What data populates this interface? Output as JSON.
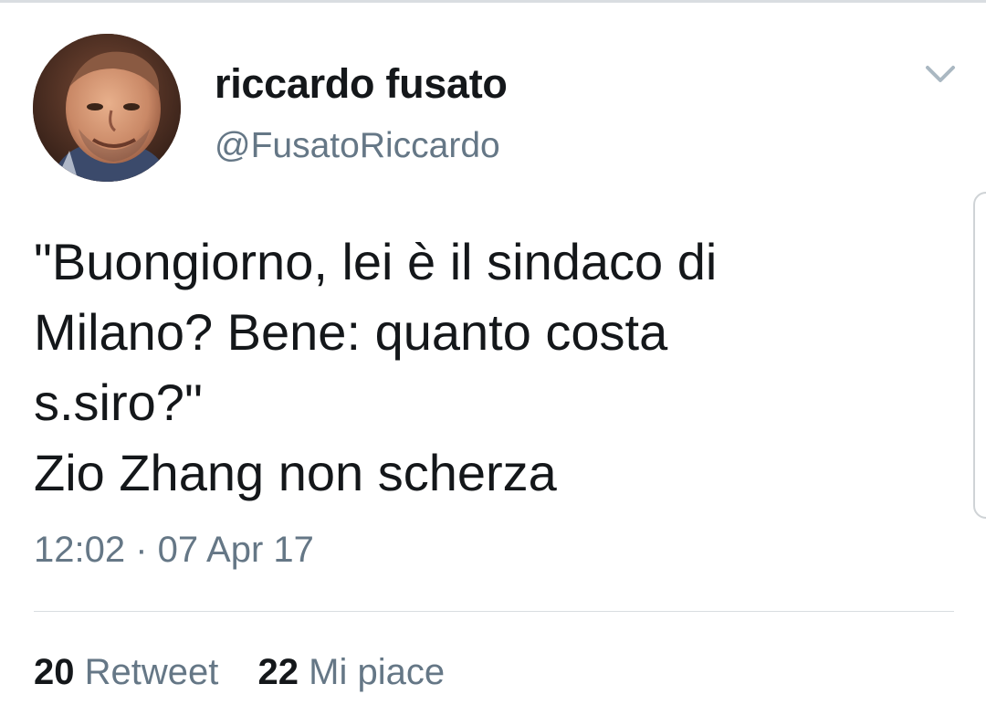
{
  "author": {
    "display_name": "riccardo fusato",
    "handle": "@FusatoRiccardo",
    "avatar_icon": "profile-photo"
  },
  "tweet": {
    "lines": [
      "\"Buongiorno, lei è il sindaco di",
      "Milano? Bene: quanto costa",
      "s.siro?\"",
      "Zio Zhang non scherza"
    ],
    "timestamp": "12:02 · 07 Apr 17"
  },
  "stats": {
    "retweets": {
      "count": "20",
      "label": "Retweet"
    },
    "likes": {
      "count": "22",
      "label": "Mi piace"
    }
  },
  "icons": {
    "menu": "chevron-down-icon"
  },
  "colors": {
    "primary_text": "#14171a",
    "secondary_text": "#657786",
    "divider": "#d9dde1"
  }
}
